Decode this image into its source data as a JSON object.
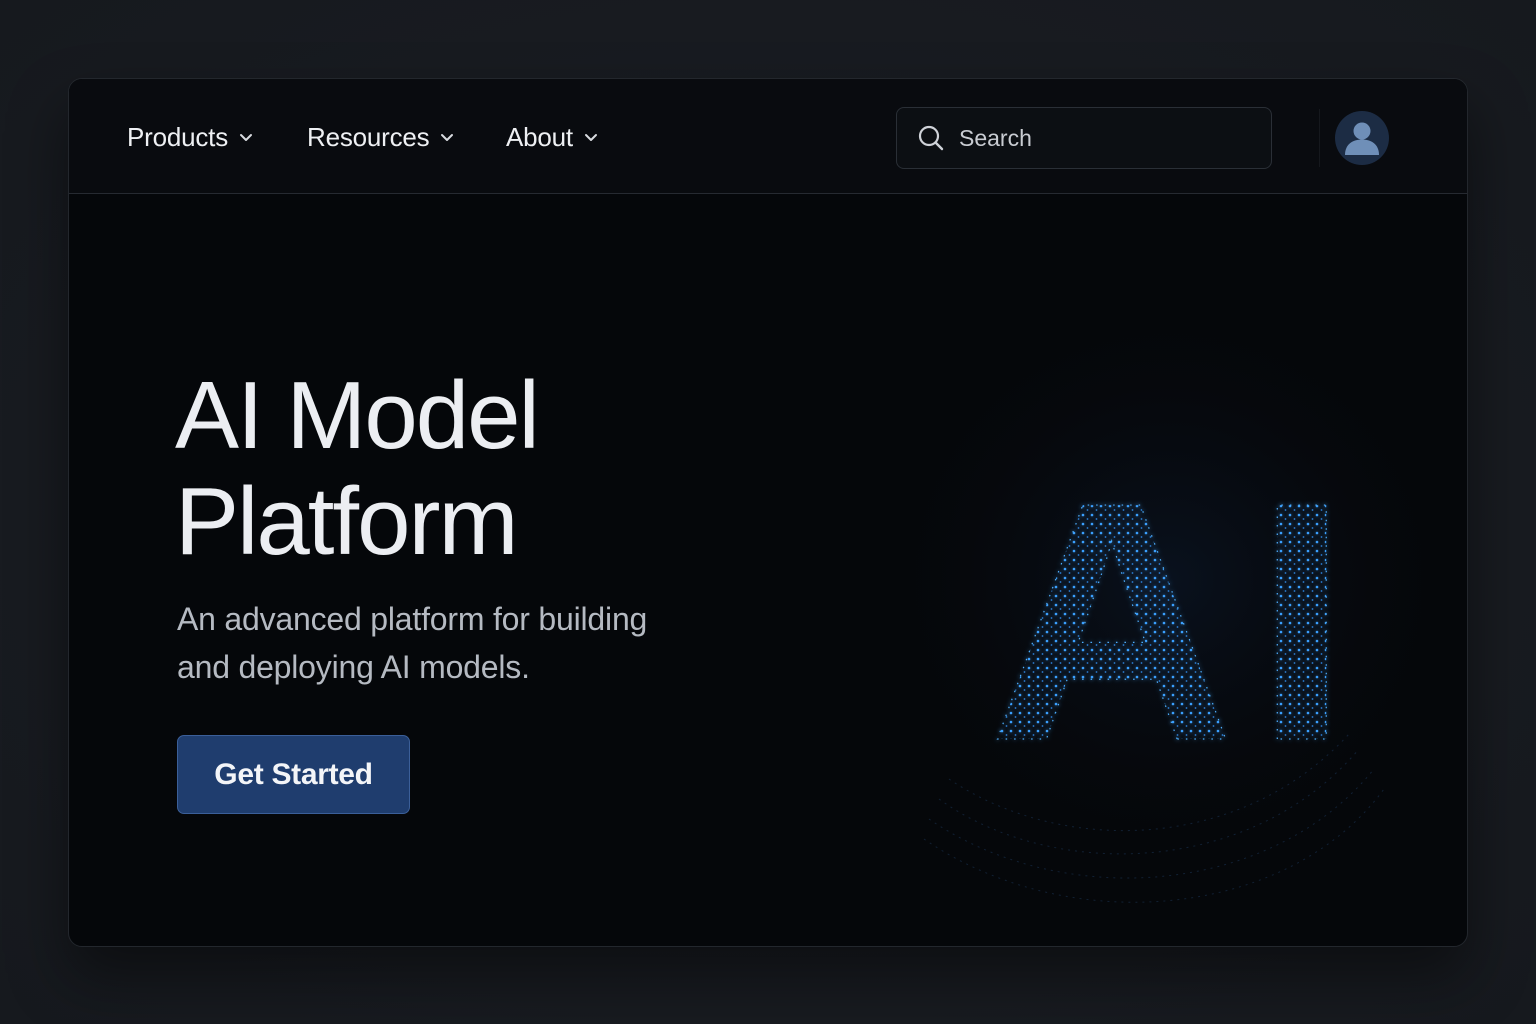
{
  "nav": {
    "items": [
      {
        "label": "Products",
        "icon": "chevron-down-icon"
      },
      {
        "label": "Resources",
        "icon": "chevron-down-icon"
      },
      {
        "label": "About",
        "icon": "chevron-down-icon"
      }
    ]
  },
  "search": {
    "placeholder": "Search",
    "value": "",
    "icon": "search-icon"
  },
  "user": {
    "icon": "avatar-user-icon"
  },
  "hero": {
    "title_line1": "AI Model",
    "title_line2": "Platform",
    "subtitle_line1": "An advanced platform for building",
    "subtitle_line2": "and deploying AI models.",
    "cta_label": "Get Started",
    "art_text": "AI"
  },
  "colors": {
    "background": "#05070a",
    "accent": "#1f3d6e",
    "glow": "#3aa0ff"
  }
}
